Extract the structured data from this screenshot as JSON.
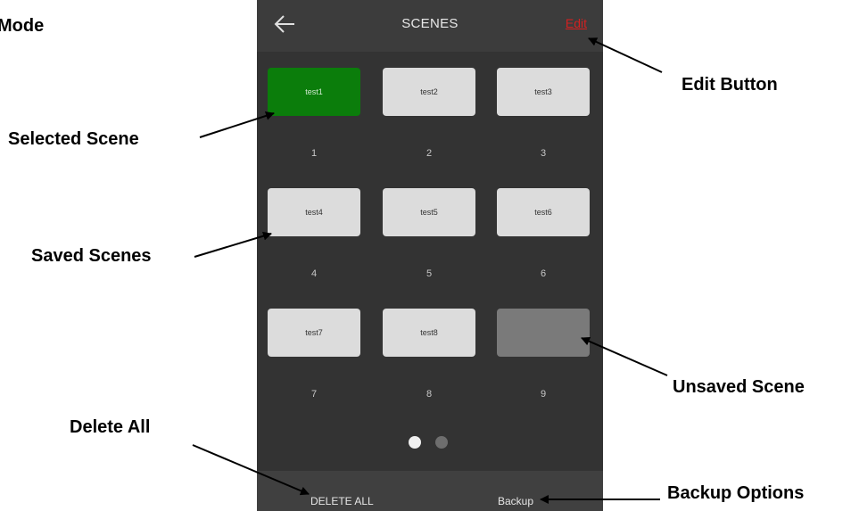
{
  "callouts": {
    "mode": "Mode",
    "edit_button": "Edit Button",
    "selected_scene": "Selected Scene",
    "saved_scenes": "Saved Scenes",
    "unsaved_scene": "Unsaved Scene",
    "delete_all": "Delete All",
    "backup_options": "Backup Options"
  },
  "appbar": {
    "title": "SCENES",
    "edit_label": "Edit",
    "back_icon": "arrow-left-icon"
  },
  "scenes": [
    {
      "label": "test1",
      "number": "1",
      "state": "selected"
    },
    {
      "label": "test2",
      "number": "2",
      "state": "saved"
    },
    {
      "label": "test3",
      "number": "3",
      "state": "saved"
    },
    {
      "label": "test4",
      "number": "4",
      "state": "saved"
    },
    {
      "label": "test5",
      "number": "5",
      "state": "saved"
    },
    {
      "label": "test6",
      "number": "6",
      "state": "saved"
    },
    {
      "label": "test7",
      "number": "7",
      "state": "saved"
    },
    {
      "label": "test8",
      "number": "8",
      "state": "saved"
    },
    {
      "label": "",
      "number": "9",
      "state": "unsaved"
    }
  ],
  "pagination": {
    "current_page": 1,
    "total_pages": 2
  },
  "bottom_bar": {
    "delete_all_label": "DELETE ALL",
    "backup_label": "Backup"
  },
  "colors": {
    "screen_bg": "#333333",
    "selected_scene": "#0b7d0b",
    "saved_scene": "#dcdcdc",
    "unsaved_scene": "#7a7a7a",
    "edit_text": "#d42020"
  }
}
